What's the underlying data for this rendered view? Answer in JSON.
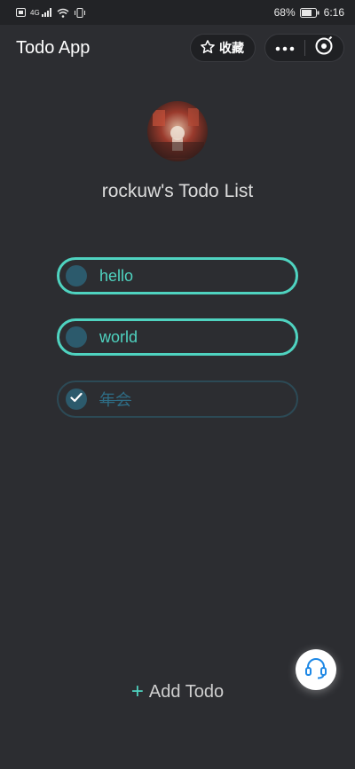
{
  "status_bar": {
    "network": "4G",
    "battery": "68%",
    "time": "6:16",
    "icons": [
      "sim-icon",
      "signal-icon",
      "wifi-icon",
      "vibrate-icon",
      "battery-icon"
    ]
  },
  "header": {
    "title": "Todo App",
    "favorite_label": "收藏",
    "icons": [
      "star-icon",
      "more-icon",
      "close-icon"
    ]
  },
  "profile": {
    "avatar_alt": "avatar",
    "list_title": "rockuw's Todo List"
  },
  "todos": [
    {
      "text": "hello",
      "completed": false
    },
    {
      "text": "world",
      "completed": false
    },
    {
      "text": "年会",
      "completed": true
    }
  ],
  "add_todo": {
    "label": "Add Todo"
  },
  "support": {
    "icon": "headset-icon"
  },
  "colors": {
    "background": "#2c2d31",
    "accent": "#4fd3c0",
    "circle": "#2c5a6c",
    "done_text": "#2e6d86"
  }
}
